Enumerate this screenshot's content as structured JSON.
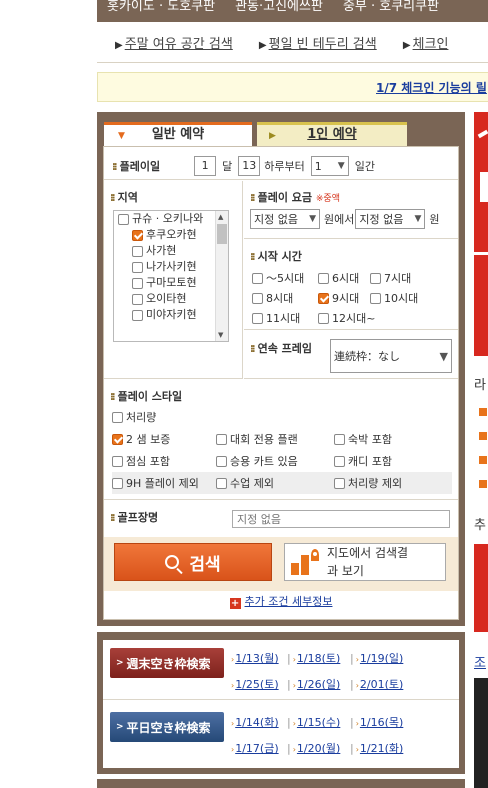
{
  "regions": [
    "홋카이도 · 도호쿠판",
    "관동·고신에쓰판",
    "중부 · 호쿠리쿠판"
  ],
  "sub_links": [
    "주말 여유 공간 검색",
    "평일 빈 테두리 검색",
    "체크인"
  ],
  "notice": "1/7 체크인 기능의 릴",
  "tabs": {
    "general": "일반 예약",
    "single": "1인 예약"
  },
  "play_day": {
    "label": "플레이일",
    "month": "1",
    "month_unit": "달",
    "day": "13",
    "from_text": "하루부터",
    "weeks": "1",
    "weeks_unit": "일간"
  },
  "area": {
    "label": "지역",
    "items": [
      {
        "name": "규슈 · 오키나와",
        "checked": false
      },
      {
        "name": "후쿠오카현",
        "checked": true
      },
      {
        "name": "사가현",
        "checked": false
      },
      {
        "name": "나가사키현",
        "checked": false
      },
      {
        "name": "구마모토현",
        "checked": false
      },
      {
        "name": "오이타현",
        "checked": false
      },
      {
        "name": "미야자키현",
        "checked": false
      }
    ]
  },
  "fee": {
    "label": "플레이 요금",
    "required": "※중액",
    "min": "지정 없음",
    "from": "원에서",
    "max": "지정 없음",
    "unit": "원"
  },
  "start_time": {
    "label": "시작 시간",
    "options": [
      {
        "label": "～5시대",
        "checked": false
      },
      {
        "label": "6시대",
        "checked": false
      },
      {
        "label": "7시대",
        "checked": false
      },
      {
        "label": "8시대",
        "checked": false
      },
      {
        "label": "9시대",
        "checked": true
      },
      {
        "label": "10시대",
        "checked": false
      },
      {
        "label": "11시대",
        "checked": false
      },
      {
        "label": "12시대~",
        "checked": false
      }
    ]
  },
  "consecutive": {
    "label": "연속 프레임",
    "value": "連続枠：なし"
  },
  "play_style": {
    "label": "플레이 스타일",
    "rows": [
      [
        {
          "label": "처리량",
          "checked": false
        }
      ],
      [
        {
          "label": "2 샘 보증",
          "checked": true
        },
        {
          "label": "대회 전용 플랜",
          "checked": false
        },
        {
          "label": "숙박 포함",
          "checked": false
        }
      ],
      [
        {
          "label": "점심 포함",
          "checked": false
        },
        {
          "label": "승용 카트 있음",
          "checked": false
        },
        {
          "label": "캐디 포함",
          "checked": false
        }
      ],
      [
        {
          "label": "9H 플레이 제외",
          "checked": false
        },
        {
          "label": "수업 제외",
          "checked": false
        },
        {
          "label": "처리량 제외",
          "checked": false
        }
      ]
    ]
  },
  "course": {
    "label": "골프장명",
    "placeholder": "지정 없음"
  },
  "buttons": {
    "search": "검색",
    "map_line1": "지도에서 검색결",
    "map_line2": "과 보기",
    "more": "추가 조건 세부정보"
  },
  "slots": {
    "weekend_label": "週末空き枠検索",
    "weekend_dates": [
      "1/13(월)",
      "1/18(토)",
      "1/19(일)",
      "1/25(토)",
      "1/26(일)",
      "2/01(토)"
    ],
    "weekday_label": "平日空き枠検索",
    "weekday_dates": [
      "1/14(화)",
      "1/15(수)",
      "1/16(목)",
      "1/17(금)",
      "1/20(월)",
      "1/21(화)"
    ]
  },
  "right_side": {
    "text1": "라",
    "text2": "추",
    "text3": "조"
  },
  "colors": {
    "brown": "#7a6555",
    "accent": "#e8731b",
    "link": "#1a3d9e",
    "weekend": "#7d211c",
    "weekday": "#254977"
  }
}
